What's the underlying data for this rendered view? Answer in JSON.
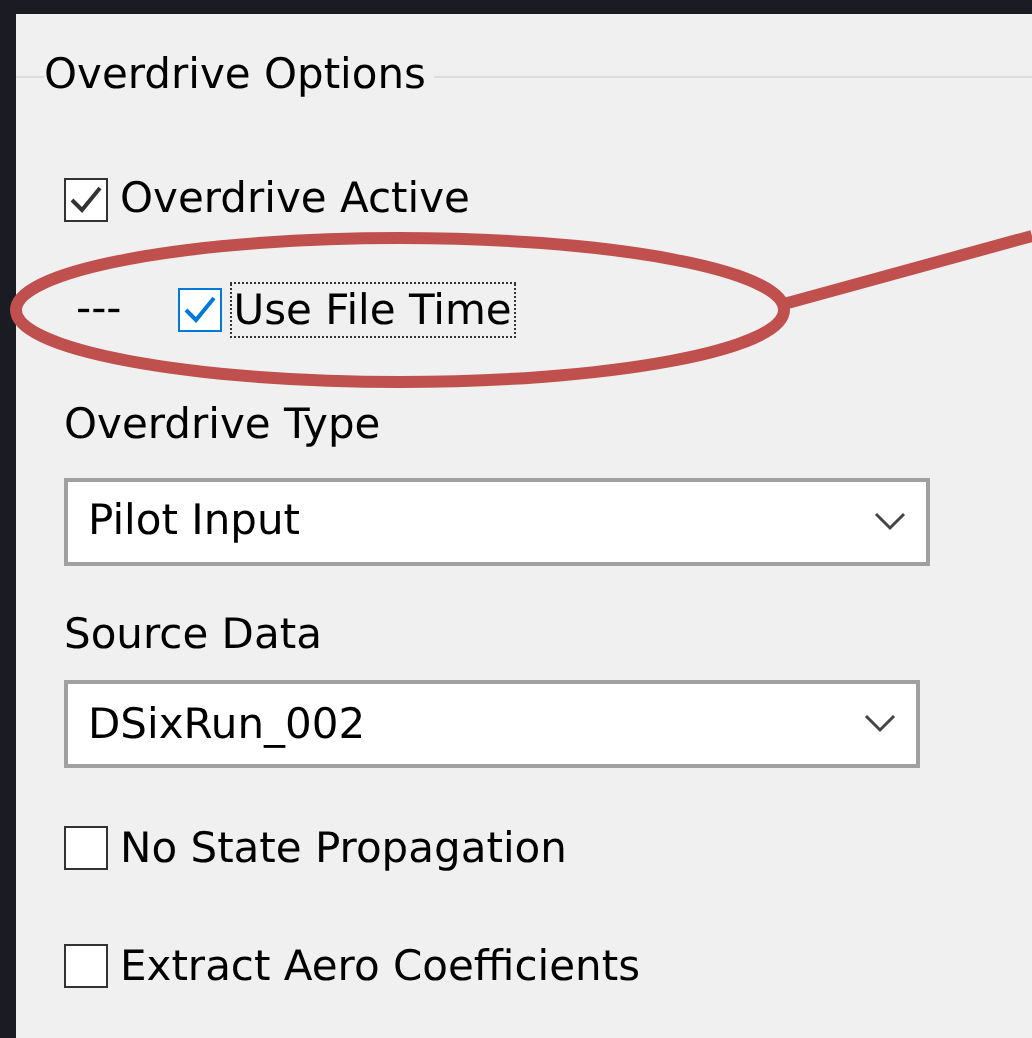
{
  "group": {
    "title": "Overdrive Options"
  },
  "controls": [
    {
      "kind": "checkbox",
      "label": "Overdrive Active",
      "checked": true,
      "focused": false
    },
    {
      "kind": "subcheckbox",
      "prefix": "---",
      "label": "Use File Time",
      "checked": true,
      "focused": true
    },
    {
      "kind": "label",
      "label": "Overdrive Type"
    },
    {
      "kind": "select",
      "value": "Pilot Input"
    },
    {
      "kind": "label",
      "label": "Source Data"
    },
    {
      "kind": "select",
      "value": "DSixRun_002"
    },
    {
      "kind": "checkbox",
      "label": "No State Propagation",
      "checked": false,
      "focused": false
    },
    {
      "kind": "checkbox",
      "label": "Extract Aero Coefficients",
      "checked": false,
      "focused": false
    }
  ]
}
